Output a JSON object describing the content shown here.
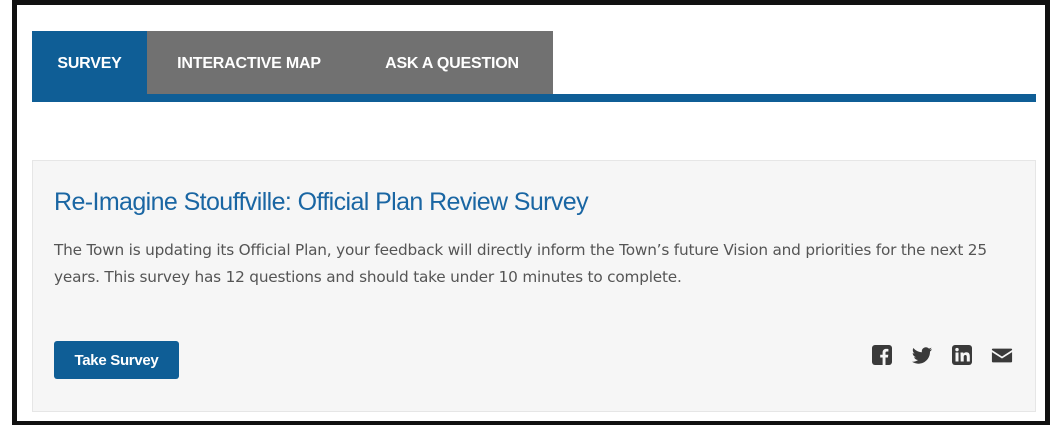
{
  "tabs": [
    {
      "label": "SURVEY",
      "active": true
    },
    {
      "label": "INTERACTIVE MAP",
      "active": false
    },
    {
      "label": "ASK A QUESTION",
      "active": false
    }
  ],
  "card": {
    "title": "Re-Imagine Stouffville: Official Plan Review Survey",
    "description": "The Town is updating its Official Plan, your feedback will directly inform the Town’s future Vision and priorities for the next 25 years.  This survey has 12 questions and should take under 10 minutes to complete.",
    "button_label": "Take Survey",
    "share_icons": [
      "facebook-icon",
      "twitter-icon",
      "linkedin-icon",
      "email-icon"
    ]
  },
  "colors": {
    "accent": "#0f5e96",
    "tab_inactive": "#717171",
    "title": "#1a66a3",
    "card_bg": "#f6f6f6"
  }
}
